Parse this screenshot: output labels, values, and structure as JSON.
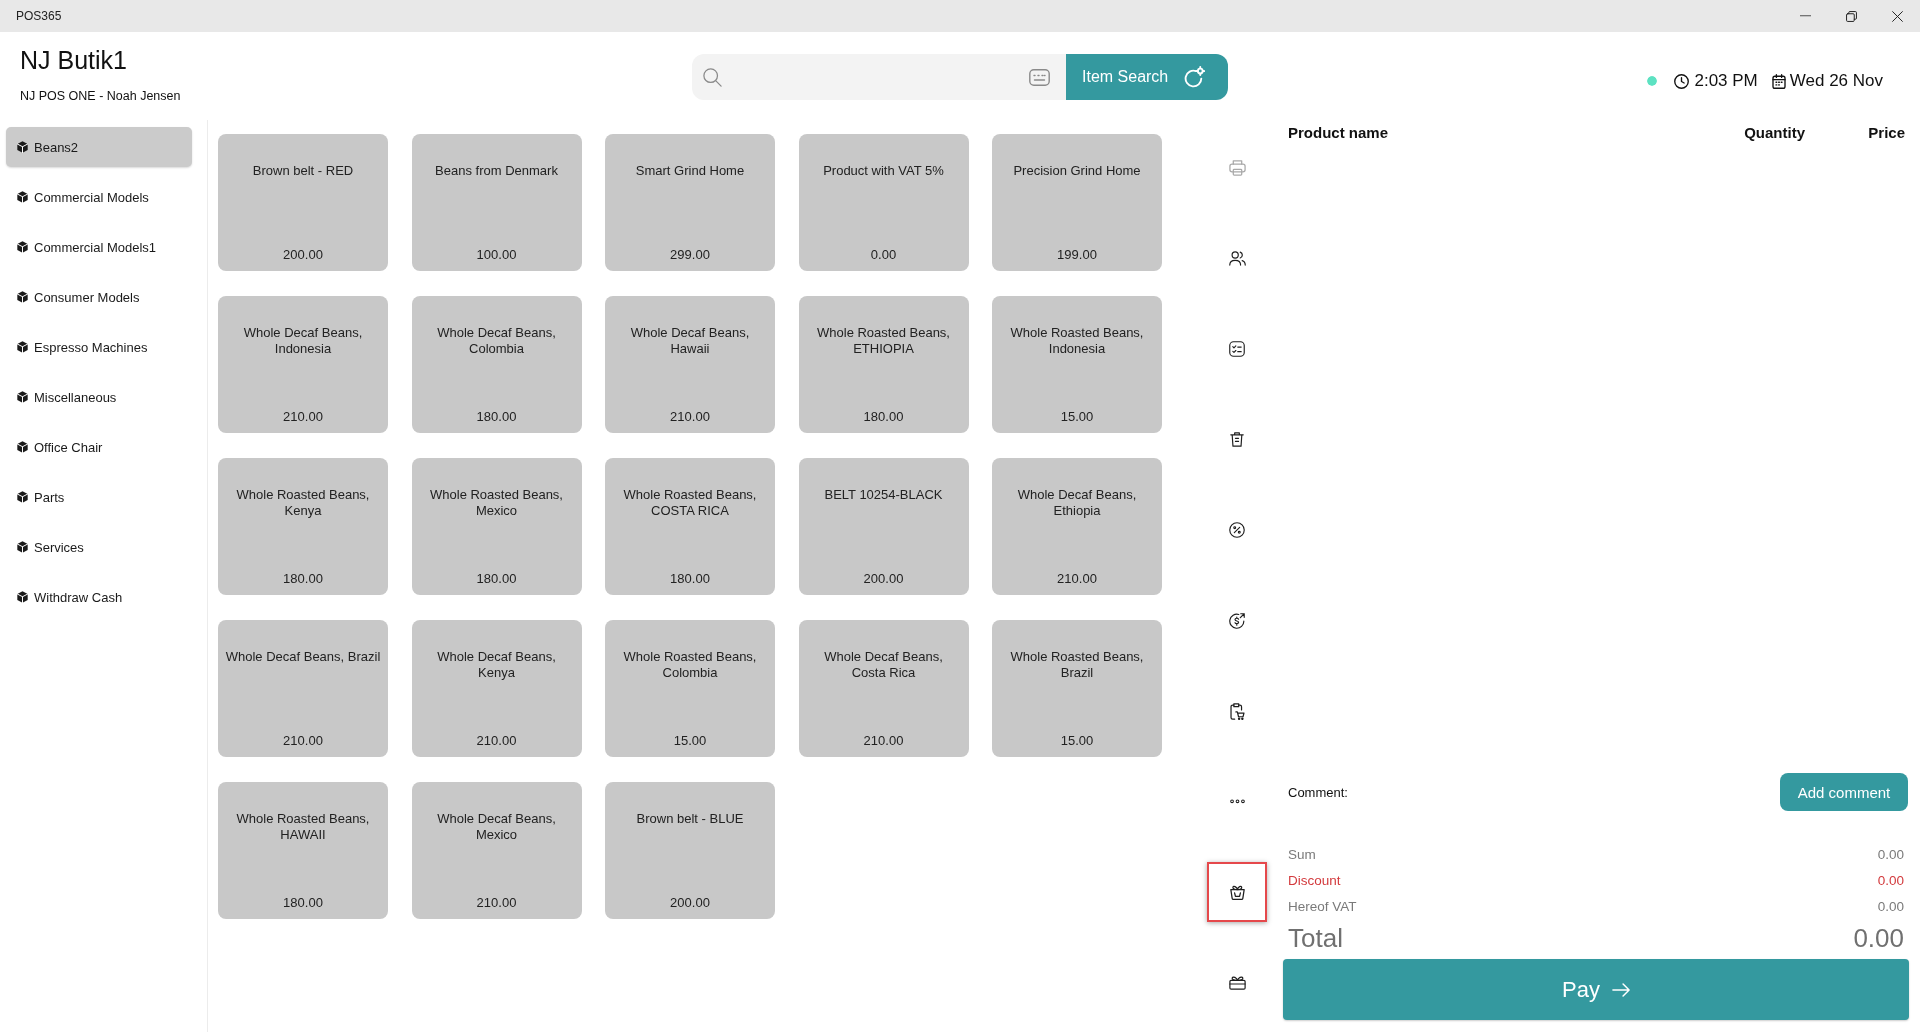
{
  "window": {
    "title": "POS365"
  },
  "store": {
    "name": "NJ Butik1",
    "register": "NJ POS ONE - Noah Jensen"
  },
  "search": {
    "button": "Item Search"
  },
  "status": {
    "online": true,
    "time": "2:03 PM",
    "date": "Wed 26 Nov"
  },
  "categories": [
    {
      "label": "Beans2",
      "selected": true
    },
    {
      "label": "Commercial Models",
      "selected": false
    },
    {
      "label": "Commercial Models1",
      "selected": false
    },
    {
      "label": "Consumer Models",
      "selected": false
    },
    {
      "label": "Espresso Machines",
      "selected": false
    },
    {
      "label": "Miscellaneous",
      "selected": false
    },
    {
      "label": "Office Chair",
      "selected": false
    },
    {
      "label": "Parts",
      "selected": false
    },
    {
      "label": "Services",
      "selected": false
    },
    {
      "label": "Withdraw Cash",
      "selected": false
    }
  ],
  "products": [
    {
      "name": "Brown belt - RED",
      "price": "200.00"
    },
    {
      "name": "Beans from Denmark",
      "price": "100.00"
    },
    {
      "name": "Smart Grind Home",
      "price": "299.00"
    },
    {
      "name": "Product with VAT 5%",
      "price": "0.00"
    },
    {
      "name": "Precision Grind Home",
      "price": "199.00"
    },
    {
      "name": "Whole Decaf Beans, Indonesia",
      "price": "210.00"
    },
    {
      "name": "Whole Decaf Beans, Colombia",
      "price": "180.00"
    },
    {
      "name": "Whole Decaf Beans, Hawaii",
      "price": "210.00"
    },
    {
      "name": "Whole Roasted Beans, ETHIOPIA",
      "price": "180.00"
    },
    {
      "name": "Whole Roasted Beans, Indonesia",
      "price": "15.00"
    },
    {
      "name": "Whole Roasted Beans, Kenya",
      "price": "180.00"
    },
    {
      "name": "Whole Roasted Beans, Mexico",
      "price": "180.00"
    },
    {
      "name": "Whole Roasted Beans, COSTA RICA",
      "price": "180.00"
    },
    {
      "name": "BELT 10254-BLACK",
      "price": "200.00"
    },
    {
      "name": "Whole Decaf Beans, Ethiopia",
      "price": "210.00"
    },
    {
      "name": "Whole Decaf Beans, Brazil",
      "price": "210.00"
    },
    {
      "name": "Whole Decaf Beans, Kenya",
      "price": "210.00"
    },
    {
      "name": "Whole Roasted Beans, Colombia",
      "price": "15.00"
    },
    {
      "name": "Whole Decaf Beans, Costa Rica",
      "price": "210.00"
    },
    {
      "name": "Whole Roasted Beans, Brazil",
      "price": "15.00"
    },
    {
      "name": "Whole Roasted Beans, HAWAII",
      "price": "180.00"
    },
    {
      "name": "Whole Decaf Beans, Mexico",
      "price": "210.00"
    },
    {
      "name": "Brown belt - BLUE",
      "price": "200.00"
    }
  ],
  "tools": [
    {
      "kind": "print",
      "disabled": true,
      "highlighted": false
    },
    {
      "kind": "customers",
      "disabled": false,
      "highlighted": false
    },
    {
      "kind": "tasks",
      "disabled": false,
      "highlighted": false
    },
    {
      "kind": "delete",
      "disabled": false,
      "highlighted": false
    },
    {
      "kind": "discount",
      "disabled": false,
      "highlighted": false
    },
    {
      "kind": "cashout",
      "disabled": false,
      "highlighted": false
    },
    {
      "kind": "cart",
      "disabled": false,
      "highlighted": false
    },
    {
      "kind": "more",
      "disabled": false,
      "highlighted": false
    },
    {
      "kind": "basket",
      "disabled": false,
      "highlighted": true
    },
    {
      "kind": "gift",
      "disabled": false,
      "highlighted": false
    }
  ],
  "order": {
    "columns": [
      "Product name",
      "Quantity",
      "Price"
    ],
    "comment_label": "Comment:",
    "add_comment_button": "Add comment",
    "totals": [
      {
        "kind": "normal",
        "label": "Sum",
        "value": "0.00"
      },
      {
        "kind": "discount",
        "label": "Discount",
        "value": "0.00"
      },
      {
        "kind": "normal",
        "label": "Hereof VAT",
        "value": "0.00"
      }
    ],
    "total": {
      "label": "Total",
      "value": "0.00"
    },
    "pay_button": "Pay"
  }
}
